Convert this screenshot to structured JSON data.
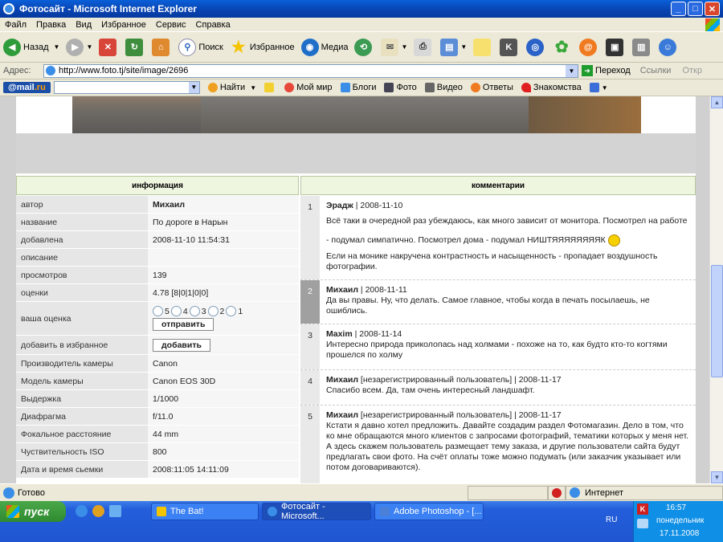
{
  "window": {
    "title": "Фотосайт - Microsoft Internet Explorer"
  },
  "menu": [
    "Файл",
    "Правка",
    "Вид",
    "Избранное",
    "Сервис",
    "Справка"
  ],
  "toolbar": {
    "back": "Назад",
    "search": "Поиск",
    "favorites": "Избранное",
    "media": "Медиа"
  },
  "address": {
    "label": "Адрес:",
    "url": "http://www.foto.tj/site/image/2696",
    "go": "Переход",
    "links": "Ссылки",
    "extra": "Откр"
  },
  "mailru": {
    "logo_a": "@mail",
    "logo_b": ".ru",
    "find": "Найти",
    "items": [
      "Мой мир",
      "Блоги",
      "Фото",
      "Видео",
      "Ответы",
      "Знакомства"
    ]
  },
  "info": {
    "header": "информация",
    "rows": [
      {
        "k": "автор",
        "v": "Михаил"
      },
      {
        "k": "название",
        "v": "По дороге в Нарын"
      },
      {
        "k": "добавлена",
        "v": "2008-11-10 11:54:31"
      },
      {
        "k": "описание",
        "v": ""
      },
      {
        "k": "просмотров",
        "v": "139"
      },
      {
        "k": "оценки",
        "v": "4.78 [8|0|1|0|0]"
      }
    ],
    "vote_label": "ваша оценка",
    "vote_options": [
      "5",
      "4",
      "3",
      "2",
      "1"
    ],
    "vote_button": "отправить",
    "fav_label": "добавить в избранное",
    "fav_button": "добавить",
    "exif": [
      {
        "k": "Производитель камеры",
        "v": "Canon"
      },
      {
        "k": "Модель камеры",
        "v": "Canon EOS 30D"
      },
      {
        "k": "Выдержка",
        "v": "1/1000"
      },
      {
        "k": "Диафрагма",
        "v": "f/11.0"
      },
      {
        "k": "Фокальное расстояние",
        "v": "44 mm"
      },
      {
        "k": "Чуствительность ISO",
        "v": "800"
      },
      {
        "k": "Дата и время сьемки",
        "v": "2008:11:05 14:11:09"
      }
    ]
  },
  "comments": {
    "header": "комментарии",
    "items": [
      {
        "n": "1",
        "author": "Эрадж",
        "meta": " | 2008-11-10",
        "text": "Всё таки в очередной раз убеждаюсь, как много зависит от монитора. Посмотрел на работе - подумал симпатично. Посмотрел дома - подумал НИШТЯЯЯЯЯЯЯЯК",
        "text2": "Если на монике накручена контрастность и насыщенность - пропадает воздушность фотографии."
      },
      {
        "n": "2",
        "author": "Михаил",
        "meta": " | 2008-11-11",
        "text": "Да вы правы. Ну, что делать. Самое главное, чтобы когда в печать посылаешь, не ошиблись.",
        "text2": ""
      },
      {
        "n": "3",
        "author": "Maxim",
        "meta": " | 2008-11-14",
        "text": "Интересно природа приколопась над холмами - похоже на то, как будто кто-то когтями прошелся по холму",
        "text2": ""
      },
      {
        "n": "4",
        "author": "Михаил",
        "meta": " [незарегистрированный пользователь] | 2008-11-17",
        "text": "Спасибо всем. Да, там очень интересный ландшафт.",
        "text2": ""
      },
      {
        "n": "5",
        "author": "Михаил",
        "meta": " [незарегистрированный пользователь] | 2008-11-17",
        "text": "Кстати я давно хотел предложить. Давайте создадим раздел Фотомагазин. Дело в том, что ко мне обращаются много клиентов с запросами фотографий, тематики которых у меня нет. А здесь скажем пользователь размещает тему заказа, и другие пользователи сайта будут предлагать свои фото. На счёт оплаты тоже можно подумать (или заказчик указывает или потом договариваются).",
        "text2": ""
      }
    ]
  },
  "status": {
    "left": "Готово",
    "zone": "Интернет"
  },
  "taskbar": {
    "start": "пуск",
    "tasks": [
      "The Bat!",
      "Фотосайт - Microsoft...",
      "Adobe Photoshop - [..."
    ],
    "lang": "RU",
    "time": "16:57",
    "day": "понедельник",
    "date": "17.11.2008"
  }
}
